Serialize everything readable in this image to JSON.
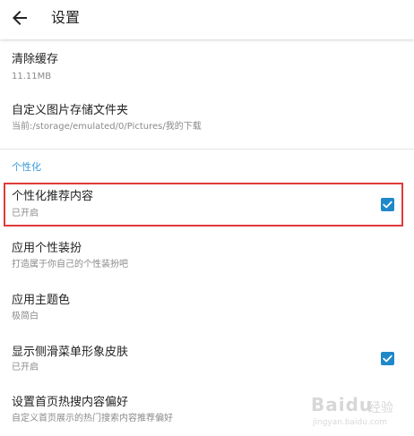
{
  "appbar": {
    "title": "设置",
    "back_icon": "arrow-back-icon"
  },
  "rows": [
    {
      "title": "清除缓存",
      "subtitle": "11.11MB",
      "checkbox": null
    },
    {
      "title": "自定义图片存储文件夹",
      "subtitle": "当前:/storage/emulated/0/Pictures/我的下载",
      "checkbox": null
    }
  ],
  "section": {
    "title": "个性化"
  },
  "personal_rows": [
    {
      "title": "个性化推荐内容",
      "subtitle": "已开启",
      "checked": true
    },
    {
      "title": "应用个性装扮",
      "subtitle": "打造属于你自己的个性装扮吧",
      "checked": null
    },
    {
      "title": "应用主题色",
      "subtitle": "极简白",
      "checked": null
    },
    {
      "title": "显示侧滑菜单形象皮肤",
      "subtitle": "已开启",
      "checked": true
    },
    {
      "title": "设置首页热搜内容偏好",
      "subtitle": "自定义首页展示的热门搜索内容推荐偏好",
      "checked": null
    }
  ],
  "watermark": {
    "text": "Baidu",
    "sub": "经验",
    "url": "jingyan.baidu.com"
  },
  "colors": {
    "accent": "#3a9ad9",
    "checkbox": "#1e88c9",
    "highlight": "#e03a3a"
  }
}
